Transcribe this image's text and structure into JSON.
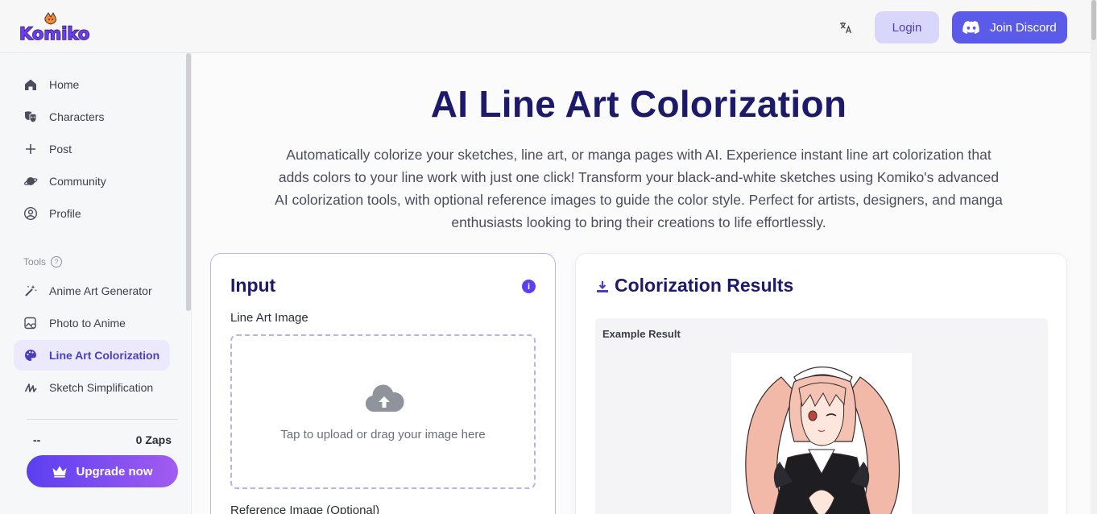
{
  "header": {
    "logo_text": "Komiko",
    "login_label": "Login",
    "discord_label": "Join Discord"
  },
  "sidebar": {
    "nav": [
      {
        "label": "Home",
        "icon": "home-icon"
      },
      {
        "label": "Characters",
        "icon": "mask-icon"
      },
      {
        "label": "Post",
        "icon": "plus-icon"
      },
      {
        "label": "Community",
        "icon": "planet-icon"
      },
      {
        "label": "Profile",
        "icon": "user-circle-icon"
      }
    ],
    "tools_label": "Tools",
    "tools": [
      {
        "label": "Anime Art Generator",
        "icon": "magic-wand-icon"
      },
      {
        "label": "Photo to Anime",
        "icon": "photo-icon"
      },
      {
        "label": "Line Art Colorization",
        "icon": "palette-icon",
        "active": true
      },
      {
        "label": "Sketch Simplification",
        "icon": "scribble-icon"
      }
    ],
    "zaps_left": "--",
    "zaps_right": "0 Zaps",
    "upgrade_label": "Upgrade now"
  },
  "main": {
    "title": "AI Line Art Colorization",
    "description": "Automatically colorize your sketches, line art, or manga pages with AI. Experience instant line art colorization that adds colors to your line work with just one click! Transform your black-and-white sketches using Komiko's advanced AI colorization tools, with optional reference images to guide the color style. Perfect for artists, designers, and manga enthusiasts looking to bring their creations to life effortlessly.",
    "input_card": {
      "title": "Input",
      "line_art_label": "Line Art Image",
      "upload_text": "Tap to upload or drag your image here",
      "reference_label": "Reference Image (Optional)"
    },
    "results_card": {
      "title": "Colorization Results",
      "example_label": "Example Result"
    }
  },
  "colors": {
    "brand_purple": "#5b3ff0",
    "title_navy": "#1d1a6b",
    "discord_blue": "#5b5bea"
  }
}
